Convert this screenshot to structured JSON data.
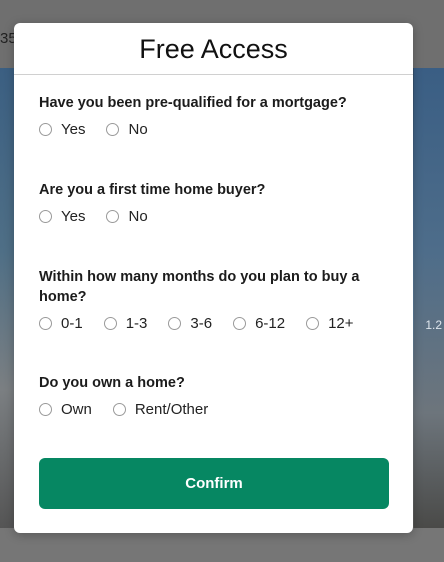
{
  "backdrop": {
    "top_text": "35",
    "badge_text": "1.2"
  },
  "modal": {
    "title": "Free Access",
    "questions": [
      {
        "label": "Have you been pre-qualified for a mortgage?",
        "options": [
          "Yes",
          "No"
        ]
      },
      {
        "label": "Are you a first time home buyer?",
        "options": [
          "Yes",
          "No"
        ]
      },
      {
        "label": "Within how many months do you plan to buy a home?",
        "options": [
          "0-1",
          "1-3",
          "3-6",
          "6-12",
          "12+"
        ]
      },
      {
        "label": "Do you own a home?",
        "options": [
          "Own",
          "Rent/Other"
        ]
      }
    ],
    "confirm_label": "Confirm"
  },
  "colors": {
    "confirm_bg": "#068762",
    "overlay": "#7d7d7d"
  }
}
